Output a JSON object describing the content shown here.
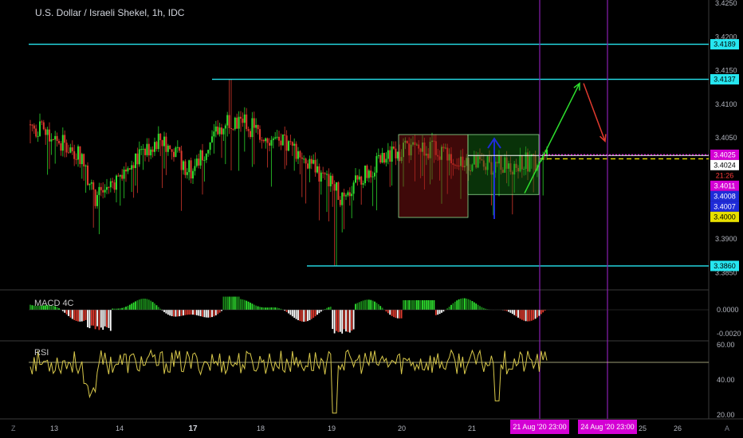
{
  "title": "U.S. Dollar / Israeli Shekel, 1h, IDC",
  "panes": {
    "macd_label": "MACD 4C",
    "rsi_label": "RSI"
  },
  "corner": {
    "left": "Z",
    "right": "A"
  },
  "colors": {
    "up": "#2ee02e",
    "down": "#e03a2e",
    "cyan": "#26e6f0",
    "magenta": "#d400d4",
    "yellow": "#e8e000",
    "blue": "#1f2bd8"
  },
  "chart_data": [
    {
      "type": "candlestick",
      "symbol": "USD/ILS",
      "y_ticks": [
        3.385,
        3.39,
        3.395,
        3.4,
        3.405,
        3.41,
        3.415,
        3.42,
        3.425
      ],
      "y_tick_labels": [
        "3.3850",
        "3.3900",
        "3.3950",
        "3.4000",
        "3.4050",
        "3.4100",
        "3.4150",
        "3.4200",
        "3.4250"
      ],
      "ylim": [
        3.3845,
        3.4252
      ],
      "x_labels": [
        "13",
        "14",
        "17",
        "18",
        "19",
        "20",
        "21",
        "24",
        "25",
        "26"
      ],
      "x_bold_labels": [
        "17"
      ],
      "price_tags": [
        {
          "value": 3.4189,
          "label": "3.4189",
          "style": "cyan"
        },
        {
          "value": 3.4137,
          "label": "3.4137",
          "style": "cyan"
        },
        {
          "value": 3.4025,
          "label": "3.4025",
          "style": "magenta"
        },
        {
          "value": 3.4024,
          "label": "3.4024",
          "style": "white"
        },
        {
          "value": 3.4019,
          "label": "21:26",
          "style": "red-text"
        },
        {
          "value": 3.4011,
          "label": "3.4011",
          "style": "magenta"
        },
        {
          "value": 3.4008,
          "label": "3.4008",
          "style": "blue"
        },
        {
          "value": 3.4007,
          "label": "3.4007",
          "style": "blue"
        },
        {
          "value": 3.4,
          "label": "3.4000",
          "style": "yellow"
        },
        {
          "value": 3.386,
          "label": "3.3860",
          "style": "cyan"
        }
      ],
      "horizontal_lines": [
        {
          "value": 3.4189,
          "from_date": "12 Aug",
          "style": "cyan"
        },
        {
          "value": 3.4137,
          "from_date": "17 Aug",
          "style": "cyan"
        },
        {
          "value": 3.386,
          "from_date": "18 Aug",
          "style": "cyan"
        },
        {
          "value": 3.4025,
          "from_date": "21 Aug",
          "style": "magenta-dotted"
        },
        {
          "value": 3.4024,
          "from_date": "21 Aug",
          "style": "white"
        },
        {
          "value": 3.4019,
          "from_date": "21 Aug",
          "style": "yellow-dashed"
        }
      ],
      "vertical_markers": [
        {
          "date": "21 Aug '20  23:00"
        },
        {
          "date": "24 Aug '20  23:00"
        }
      ],
      "boxes": [
        {
          "from": "19 Aug 20:00",
          "to": "20 Aug 20:00",
          "y_from": 3.3932,
          "y_to": 3.4055,
          "style": "red"
        },
        {
          "from": "20 Aug 20:00",
          "to": "21 Aug 23:00",
          "y_from": 3.3966,
          "y_to": 3.4055,
          "style": "green"
        }
      ],
      "projection": [
        {
          "from_date": "21 Aug 20:00",
          "from_value": 3.3968,
          "to_date": "22 Aug 21:00",
          "to_value": 3.4131,
          "color": "green"
        },
        {
          "from_date": "22 Aug 22:00",
          "from_value": 3.4131,
          "to_date": "24 Aug 01:00",
          "to_value": 3.4045,
          "color": "red"
        }
      ],
      "date_range": [
        "12 Aug 2020",
        "26 Aug 2020"
      ],
      "last_close": 3.4019
    },
    {
      "type": "bar",
      "name": "MACD 4C",
      "y_ticks": [
        0.0,
        -0.002
      ],
      "y_tick_labels": [
        "0.0000",
        "-0.0020"
      ],
      "ylim": [
        -0.0026,
        0.0015
      ]
    },
    {
      "type": "line",
      "name": "RSI",
      "y_ticks": [
        60,
        40,
        20
      ],
      "y_tick_labels": [
        "60.00",
        "40.00",
        "20.00"
      ],
      "ylim": [
        18,
        62
      ],
      "reference_line": 50
    }
  ]
}
